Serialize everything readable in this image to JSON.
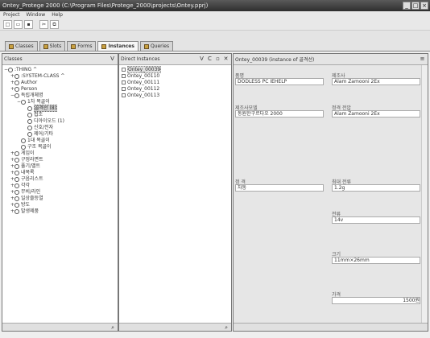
{
  "window": {
    "title": "Ontey_Protege 2000   (C:\\Program Files\\Protege_2000\\projects\\Ontey.pprj)"
  },
  "menu": [
    "Project",
    "Window",
    "Help"
  ],
  "toolbar": [
    "new",
    "open",
    "save",
    "cut",
    "copy"
  ],
  "tabs": [
    {
      "label": "Classes",
      "active": false
    },
    {
      "label": "Slots",
      "active": false
    },
    {
      "label": "Forms",
      "active": false
    },
    {
      "label": "Instances",
      "active": true
    },
    {
      "label": "Queries",
      "active": false
    }
  ],
  "class_pane": {
    "header": "Classes",
    "tree": [
      {
        "label": ":THING ^",
        "depth": 0,
        "toggle": "−"
      },
      {
        "label": ":SYSTEM-CLASS ^",
        "depth": 1,
        "toggle": "+"
      },
      {
        "label": "Author",
        "depth": 1,
        "toggle": "+"
      },
      {
        "label": "Person",
        "depth": 1,
        "toggle": "+"
      },
      {
        "label": "독립개체명",
        "depth": 1,
        "toggle": "−"
      },
      {
        "label": "1차 목골이",
        "depth": 2,
        "toggle": "−"
      },
      {
        "label": "골격선 (8)",
        "depth": 3,
        "toggle": "",
        "selected": true
      },
      {
        "label": "접조",
        "depth": 3,
        "toggle": ""
      },
      {
        "label": "디아이오드 (1)",
        "depth": 3,
        "toggle": ""
      },
      {
        "label": "신호/전자",
        "depth": 3,
        "toggle": ""
      },
      {
        "label": "제어/기타",
        "depth": 3,
        "toggle": ""
      },
      {
        "label": "1대 목골이",
        "depth": 2,
        "toggle": ""
      },
      {
        "label": "구조 목골이",
        "depth": 2,
        "toggle": ""
      },
      {
        "label": "게임이",
        "depth": 1,
        "toggle": "+"
      },
      {
        "label": "구멍라면트",
        "depth": 1,
        "toggle": "+"
      },
      {
        "label": "퓰기/밸트",
        "depth": 1,
        "toggle": "+"
      },
      {
        "label": "내목록",
        "depth": 1,
        "toggle": "+"
      },
      {
        "label": "구음리스트",
        "depth": 1,
        "toggle": "+"
      },
      {
        "label": "각각",
        "depth": 1,
        "toggle": "+"
      },
      {
        "label": "무비/라인",
        "depth": 1,
        "toggle": "+"
      },
      {
        "label": "일상즐등열",
        "depth": 1,
        "toggle": "+"
      },
      {
        "label": "방도",
        "depth": 1,
        "toggle": "+"
      },
      {
        "label": "발생제품",
        "depth": 1,
        "toggle": "+"
      }
    ]
  },
  "instance_pane": {
    "header": "Direct Instances",
    "items": [
      {
        "label": "Ontey_00039",
        "selected": true
      },
      {
        "label": "Ontey_00110",
        "selected": false
      },
      {
        "label": "Ontey_00111",
        "selected": false
      },
      {
        "label": "Ontey_00112",
        "selected": false
      },
      {
        "label": "Ontey_00113",
        "selected": false
      }
    ]
  },
  "form_pane": {
    "header": "Ontey_00039   (instance of 골격선)",
    "fields": [
      {
        "label": "품명",
        "value": "DODLESS PC IEHELP"
      },
      {
        "label": "제조사",
        "value": "Alam Zamooni 2Ex"
      },
      {
        "label": "제조사모델",
        "value": "동원한구르다오 2000"
      },
      {
        "label": "정격 전압",
        "value": "Alam Zamooni 2Ex"
      },
      {
        "label": "정 격",
        "value": "자동"
      },
      {
        "label": "최대 전류",
        "value": "1.2g"
      },
      {
        "label": "전류",
        "value": "14v"
      },
      {
        "label": "크기",
        "value": "11mm×26mm"
      },
      {
        "label": "가격",
        "value": "1500원"
      }
    ]
  }
}
